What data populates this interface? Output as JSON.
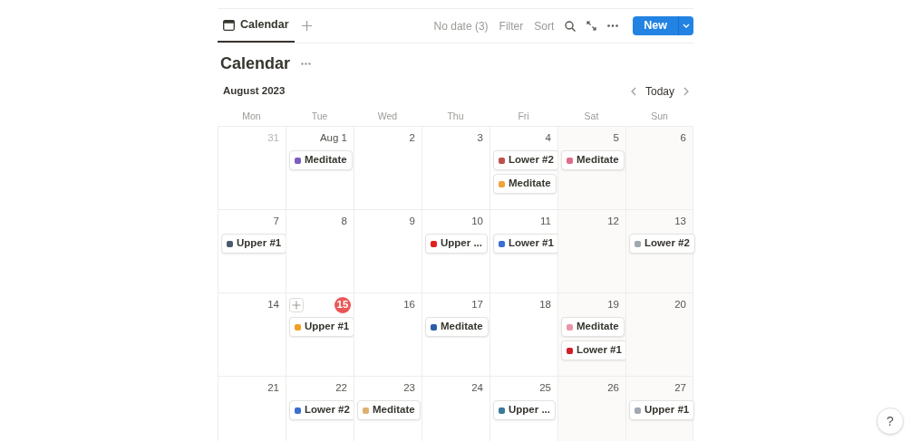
{
  "tabs": [
    {
      "label": "Calendar",
      "selected": true
    }
  ],
  "toolbar": {
    "no_date": "No date (3)",
    "filter": "Filter",
    "sort": "Sort",
    "new_button": "New"
  },
  "title": "Calendar",
  "month": "August 2023",
  "today_button": "Today",
  "weekdays": [
    "Mon",
    "Tue",
    "Wed",
    "Thu",
    "Fri",
    "Sat",
    "Sun"
  ],
  "weeks": [
    [
      {
        "label": "31",
        "muted": true,
        "today": false
      },
      {
        "label": "Aug 1",
        "muted": false,
        "today": false,
        "events": [
          {
            "title": "Meditate",
            "color": "#7c5cbf"
          }
        ]
      },
      {
        "label": "2",
        "muted": false,
        "today": false
      },
      {
        "label": "3",
        "muted": false,
        "today": false
      },
      {
        "label": "4",
        "muted": false,
        "today": false,
        "events": [
          {
            "title": "Lower #2",
            "color": "#c0504d"
          },
          {
            "title": "Meditate",
            "color": "#f2a33a"
          }
        ]
      },
      {
        "label": "5",
        "muted": false,
        "today": false,
        "events": [
          {
            "title": "Meditate",
            "color": "#e06c8a"
          }
        ]
      },
      {
        "label": "6",
        "muted": false,
        "today": false
      }
    ],
    [
      {
        "label": "7",
        "muted": false,
        "today": false,
        "events": [
          {
            "title": "Upper #1",
            "color": "#4a5a6a"
          }
        ]
      },
      {
        "label": "8",
        "muted": false,
        "today": false
      },
      {
        "label": "9",
        "muted": false,
        "today": false
      },
      {
        "label": "10",
        "muted": false,
        "today": false,
        "events": [
          {
            "title": "Upper ...",
            "color": "#e02020"
          }
        ]
      },
      {
        "label": "11",
        "muted": false,
        "today": false,
        "events": [
          {
            "title": "Lower #1",
            "color": "#3a6fd0"
          }
        ]
      },
      {
        "label": "12",
        "muted": false,
        "today": false
      },
      {
        "label": "13",
        "muted": false,
        "today": false,
        "events": [
          {
            "title": "Lower #2",
            "color": "#a0a8b0"
          }
        ]
      }
    ],
    [
      {
        "label": "14",
        "muted": false,
        "today": false
      },
      {
        "label": "15",
        "muted": false,
        "today": true,
        "events": [
          {
            "title": "Upper #1",
            "color": "#f0a020"
          }
        ]
      },
      {
        "label": "16",
        "muted": false,
        "today": false
      },
      {
        "label": "17",
        "muted": false,
        "today": false,
        "events": [
          {
            "title": "Meditate",
            "color": "#2a5ea8"
          }
        ]
      },
      {
        "label": "18",
        "muted": false,
        "today": false
      },
      {
        "label": "19",
        "muted": false,
        "today": false,
        "events": [
          {
            "title": "Meditate",
            "color": "#e895a8"
          },
          {
            "title": "Lower #1",
            "color": "#d0202a"
          }
        ]
      },
      {
        "label": "20",
        "muted": false,
        "today": false
      }
    ],
    [
      {
        "label": "21",
        "muted": false,
        "today": false
      },
      {
        "label": "22",
        "muted": false,
        "today": false,
        "events": [
          {
            "title": "Lower #2",
            "color": "#3a6fd0"
          }
        ]
      },
      {
        "label": "23",
        "muted": false,
        "today": false,
        "events": [
          {
            "title": "Meditate",
            "color": "#e0b070"
          }
        ]
      },
      {
        "label": "24",
        "muted": false,
        "today": false
      },
      {
        "label": "25",
        "muted": false,
        "today": false,
        "events": [
          {
            "title": "Upper ...",
            "color": "#3a7a9a"
          }
        ]
      },
      {
        "label": "26",
        "muted": false,
        "today": false
      },
      {
        "label": "27",
        "muted": false,
        "today": false,
        "events": [
          {
            "title": "Upper #1",
            "color": "#a0a8b0"
          }
        ]
      }
    ]
  ],
  "help": "?"
}
